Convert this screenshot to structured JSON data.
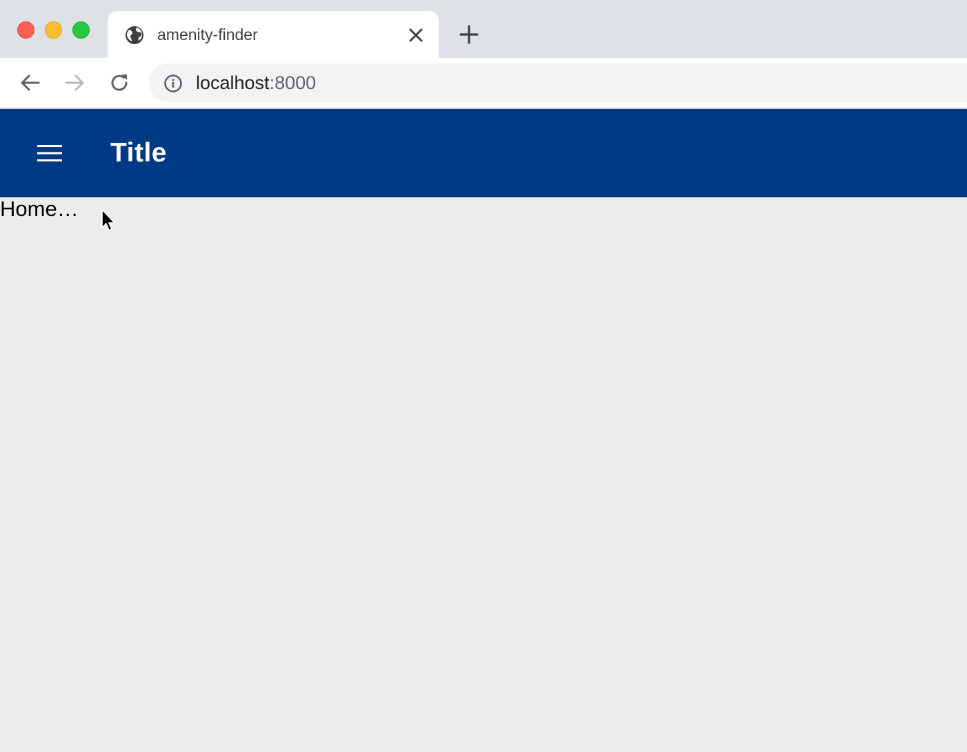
{
  "browser": {
    "tab": {
      "title": "amenity-finder",
      "favicon": "globe-icon"
    },
    "address": {
      "host": "localhost",
      "port": ":8000"
    },
    "icons": {
      "back": "arrow-left-icon",
      "forward": "arrow-right-icon",
      "reload": "reload-icon",
      "info": "info-icon",
      "close": "close-icon",
      "new_tab": "plus-icon"
    }
  },
  "app": {
    "title": "Title",
    "menu_icon": "hamburger-menu-icon",
    "bar_color": "#003a84"
  },
  "content": {
    "text": "Home…"
  }
}
